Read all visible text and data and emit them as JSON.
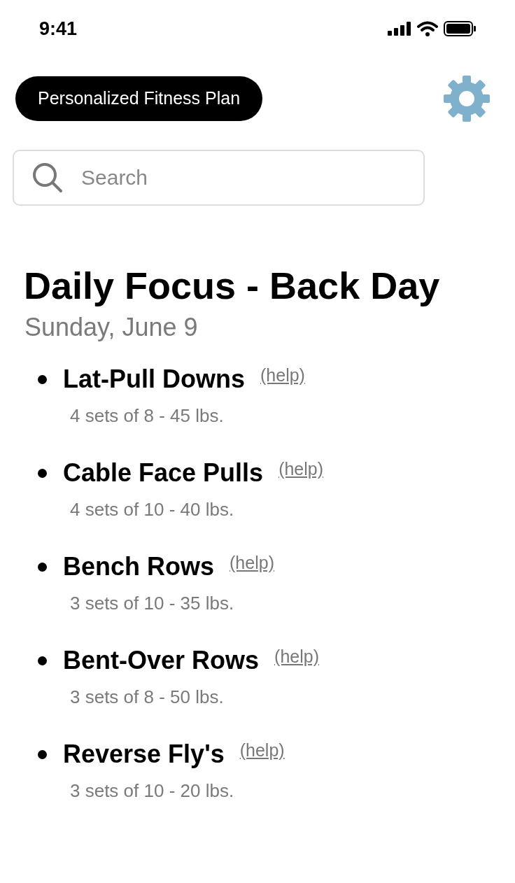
{
  "status_bar": {
    "time": "9:41"
  },
  "header": {
    "title": "Personalized Fitness Plan"
  },
  "search": {
    "placeholder": "Search"
  },
  "heading": "Daily Focus - Back Day",
  "date": "Sunday, June 9",
  "exercises": [
    {
      "name": "Lat-Pull Downs",
      "help": "(help)",
      "detail": "4 sets of 8 - 45 lbs."
    },
    {
      "name": "Cable Face Pulls",
      "help": "(help)",
      "detail": "4 sets of 10 - 40 lbs."
    },
    {
      "name": "Bench Rows",
      "help": "(help)",
      "detail": "3 sets of 10 - 35 lbs."
    },
    {
      "name": "Bent-Over Rows",
      "help": "(help)",
      "detail": "3 sets of 8 - 50 lbs."
    },
    {
      "name": "Reverse Fly's",
      "help": "(help)",
      "detail": "3 sets of 10 - 20 lbs."
    }
  ]
}
